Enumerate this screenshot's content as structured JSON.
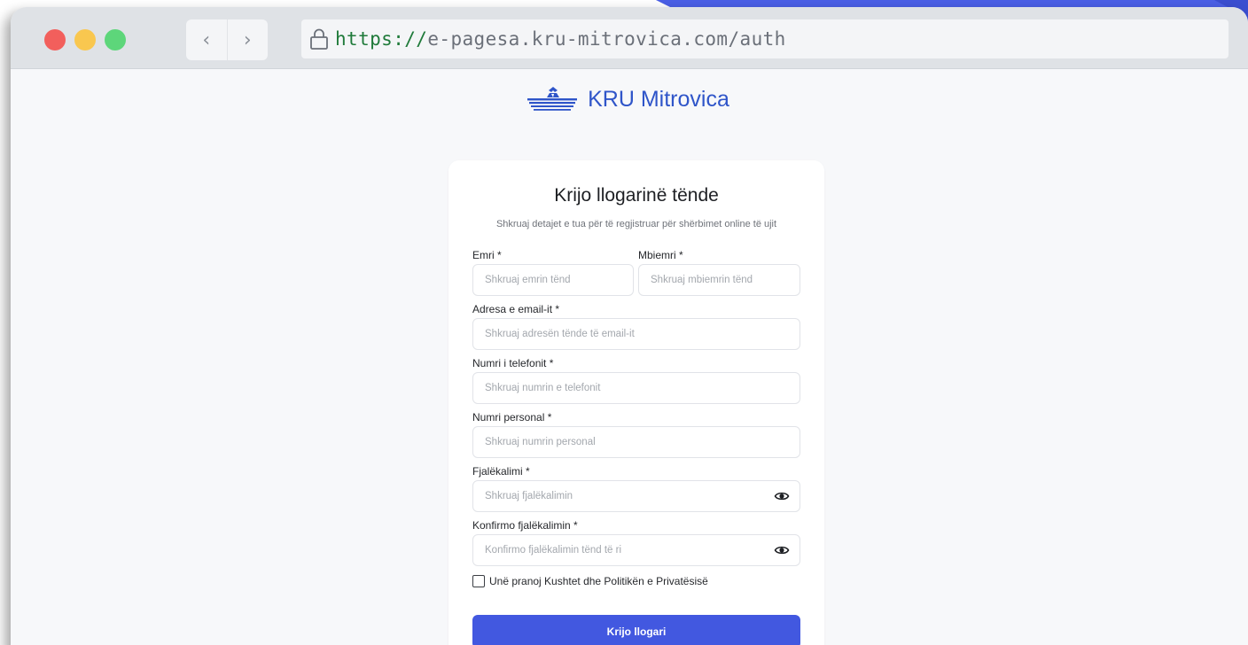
{
  "browser": {
    "back_glyph": "‹",
    "forward_glyph": "›",
    "url_scheme": "https://",
    "url_rest": "e-pagesa.kru-mitrovica.com/auth",
    "controls": [
      "close-dot",
      "minimize-dot",
      "maximize-dot"
    ]
  },
  "brand": {
    "name": "KRU Mitrovica"
  },
  "form": {
    "title": "Krijo llogarinë tënde",
    "subtitle": "Shkruaj detajet e tua për të regjistruar për shërbimet online të ujit",
    "first_name": {
      "label": "Emri *",
      "placeholder": "Shkruaj emrin tënd",
      "value": ""
    },
    "last_name": {
      "label": "Mbiemri *",
      "placeholder": "Shkruaj mbiemrin tënd",
      "value": ""
    },
    "email": {
      "label": "Adresa e email-it *",
      "placeholder": "Shkruaj adresën tënde të email-it",
      "value": ""
    },
    "phone": {
      "label": "Numri i telefonit *",
      "placeholder": "Shkruaj numrin e telefonit",
      "value": ""
    },
    "personal_number": {
      "label": "Numri personal *",
      "placeholder": "Shkruaj numrin personal",
      "value": ""
    },
    "password": {
      "label": "Fjalëkalimi *",
      "placeholder": "Shkruaj fjalëkalimin",
      "value": ""
    },
    "confirm_password": {
      "label": "Konfirmo fjalëkalimin *",
      "placeholder": "Konfirmo fjalëkalimin tënd të ri",
      "value": ""
    },
    "terms_label": "Unë pranoj Kushtet dhe Politikën e Privatësisë",
    "terms_checked": false,
    "submit_label": "Krijo llogari"
  },
  "colors": {
    "accent": "#4258e0",
    "brand_text": "#2f55c9",
    "url_scheme": "#1f7a3a",
    "background_accent": "#4a5fe6"
  },
  "icons": {
    "lock": "lock-icon",
    "eye": "eye-icon",
    "logo": "kru-logo-icon"
  }
}
